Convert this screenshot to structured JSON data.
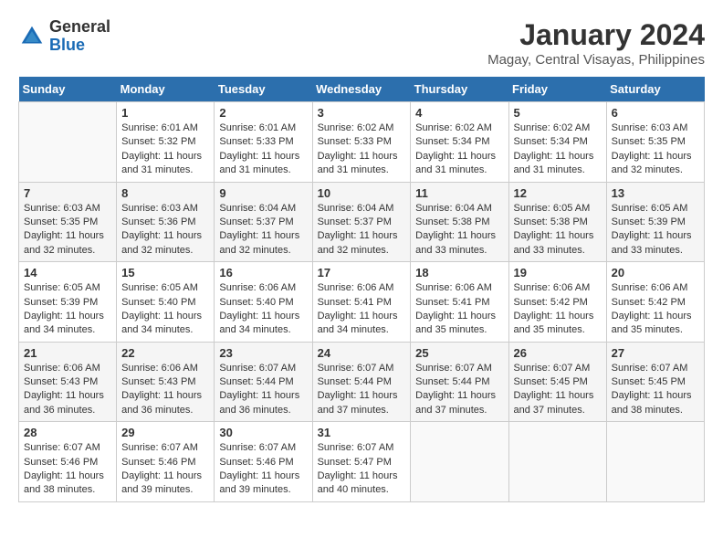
{
  "logo": {
    "general": "General",
    "blue": "Blue"
  },
  "title": "January 2024",
  "location": "Magay, Central Visayas, Philippines",
  "weekdays": [
    "Sunday",
    "Monday",
    "Tuesday",
    "Wednesday",
    "Thursday",
    "Friday",
    "Saturday"
  ],
  "weeks": [
    [
      {
        "day": "",
        "sunrise": "",
        "sunset": "",
        "daylight": ""
      },
      {
        "day": "1",
        "sunrise": "Sunrise: 6:01 AM",
        "sunset": "Sunset: 5:32 PM",
        "daylight": "Daylight: 11 hours and 31 minutes."
      },
      {
        "day": "2",
        "sunrise": "Sunrise: 6:01 AM",
        "sunset": "Sunset: 5:33 PM",
        "daylight": "Daylight: 11 hours and 31 minutes."
      },
      {
        "day": "3",
        "sunrise": "Sunrise: 6:02 AM",
        "sunset": "Sunset: 5:33 PM",
        "daylight": "Daylight: 11 hours and 31 minutes."
      },
      {
        "day": "4",
        "sunrise": "Sunrise: 6:02 AM",
        "sunset": "Sunset: 5:34 PM",
        "daylight": "Daylight: 11 hours and 31 minutes."
      },
      {
        "day": "5",
        "sunrise": "Sunrise: 6:02 AM",
        "sunset": "Sunset: 5:34 PM",
        "daylight": "Daylight: 11 hours and 31 minutes."
      },
      {
        "day": "6",
        "sunrise": "Sunrise: 6:03 AM",
        "sunset": "Sunset: 5:35 PM",
        "daylight": "Daylight: 11 hours and 32 minutes."
      }
    ],
    [
      {
        "day": "7",
        "sunrise": "Sunrise: 6:03 AM",
        "sunset": "Sunset: 5:35 PM",
        "daylight": "Daylight: 11 hours and 32 minutes."
      },
      {
        "day": "8",
        "sunrise": "Sunrise: 6:03 AM",
        "sunset": "Sunset: 5:36 PM",
        "daylight": "Daylight: 11 hours and 32 minutes."
      },
      {
        "day": "9",
        "sunrise": "Sunrise: 6:04 AM",
        "sunset": "Sunset: 5:37 PM",
        "daylight": "Daylight: 11 hours and 32 minutes."
      },
      {
        "day": "10",
        "sunrise": "Sunrise: 6:04 AM",
        "sunset": "Sunset: 5:37 PM",
        "daylight": "Daylight: 11 hours and 32 minutes."
      },
      {
        "day": "11",
        "sunrise": "Sunrise: 6:04 AM",
        "sunset": "Sunset: 5:38 PM",
        "daylight": "Daylight: 11 hours and 33 minutes."
      },
      {
        "day": "12",
        "sunrise": "Sunrise: 6:05 AM",
        "sunset": "Sunset: 5:38 PM",
        "daylight": "Daylight: 11 hours and 33 minutes."
      },
      {
        "day": "13",
        "sunrise": "Sunrise: 6:05 AM",
        "sunset": "Sunset: 5:39 PM",
        "daylight": "Daylight: 11 hours and 33 minutes."
      }
    ],
    [
      {
        "day": "14",
        "sunrise": "Sunrise: 6:05 AM",
        "sunset": "Sunset: 5:39 PM",
        "daylight": "Daylight: 11 hours and 34 minutes."
      },
      {
        "day": "15",
        "sunrise": "Sunrise: 6:05 AM",
        "sunset": "Sunset: 5:40 PM",
        "daylight": "Daylight: 11 hours and 34 minutes."
      },
      {
        "day": "16",
        "sunrise": "Sunrise: 6:06 AM",
        "sunset": "Sunset: 5:40 PM",
        "daylight": "Daylight: 11 hours and 34 minutes."
      },
      {
        "day": "17",
        "sunrise": "Sunrise: 6:06 AM",
        "sunset": "Sunset: 5:41 PM",
        "daylight": "Daylight: 11 hours and 34 minutes."
      },
      {
        "day": "18",
        "sunrise": "Sunrise: 6:06 AM",
        "sunset": "Sunset: 5:41 PM",
        "daylight": "Daylight: 11 hours and 35 minutes."
      },
      {
        "day": "19",
        "sunrise": "Sunrise: 6:06 AM",
        "sunset": "Sunset: 5:42 PM",
        "daylight": "Daylight: 11 hours and 35 minutes."
      },
      {
        "day": "20",
        "sunrise": "Sunrise: 6:06 AM",
        "sunset": "Sunset: 5:42 PM",
        "daylight": "Daylight: 11 hours and 35 minutes."
      }
    ],
    [
      {
        "day": "21",
        "sunrise": "Sunrise: 6:06 AM",
        "sunset": "Sunset: 5:43 PM",
        "daylight": "Daylight: 11 hours and 36 minutes."
      },
      {
        "day": "22",
        "sunrise": "Sunrise: 6:06 AM",
        "sunset": "Sunset: 5:43 PM",
        "daylight": "Daylight: 11 hours and 36 minutes."
      },
      {
        "day": "23",
        "sunrise": "Sunrise: 6:07 AM",
        "sunset": "Sunset: 5:44 PM",
        "daylight": "Daylight: 11 hours and 36 minutes."
      },
      {
        "day": "24",
        "sunrise": "Sunrise: 6:07 AM",
        "sunset": "Sunset: 5:44 PM",
        "daylight": "Daylight: 11 hours and 37 minutes."
      },
      {
        "day": "25",
        "sunrise": "Sunrise: 6:07 AM",
        "sunset": "Sunset: 5:44 PM",
        "daylight": "Daylight: 11 hours and 37 minutes."
      },
      {
        "day": "26",
        "sunrise": "Sunrise: 6:07 AM",
        "sunset": "Sunset: 5:45 PM",
        "daylight": "Daylight: 11 hours and 37 minutes."
      },
      {
        "day": "27",
        "sunrise": "Sunrise: 6:07 AM",
        "sunset": "Sunset: 5:45 PM",
        "daylight": "Daylight: 11 hours and 38 minutes."
      }
    ],
    [
      {
        "day": "28",
        "sunrise": "Sunrise: 6:07 AM",
        "sunset": "Sunset: 5:46 PM",
        "daylight": "Daylight: 11 hours and 38 minutes."
      },
      {
        "day": "29",
        "sunrise": "Sunrise: 6:07 AM",
        "sunset": "Sunset: 5:46 PM",
        "daylight": "Daylight: 11 hours and 39 minutes."
      },
      {
        "day": "30",
        "sunrise": "Sunrise: 6:07 AM",
        "sunset": "Sunset: 5:46 PM",
        "daylight": "Daylight: 11 hours and 39 minutes."
      },
      {
        "day": "31",
        "sunrise": "Sunrise: 6:07 AM",
        "sunset": "Sunset: 5:47 PM",
        "daylight": "Daylight: 11 hours and 40 minutes."
      },
      {
        "day": "",
        "sunrise": "",
        "sunset": "",
        "daylight": ""
      },
      {
        "day": "",
        "sunrise": "",
        "sunset": "",
        "daylight": ""
      },
      {
        "day": "",
        "sunrise": "",
        "sunset": "",
        "daylight": ""
      }
    ]
  ]
}
